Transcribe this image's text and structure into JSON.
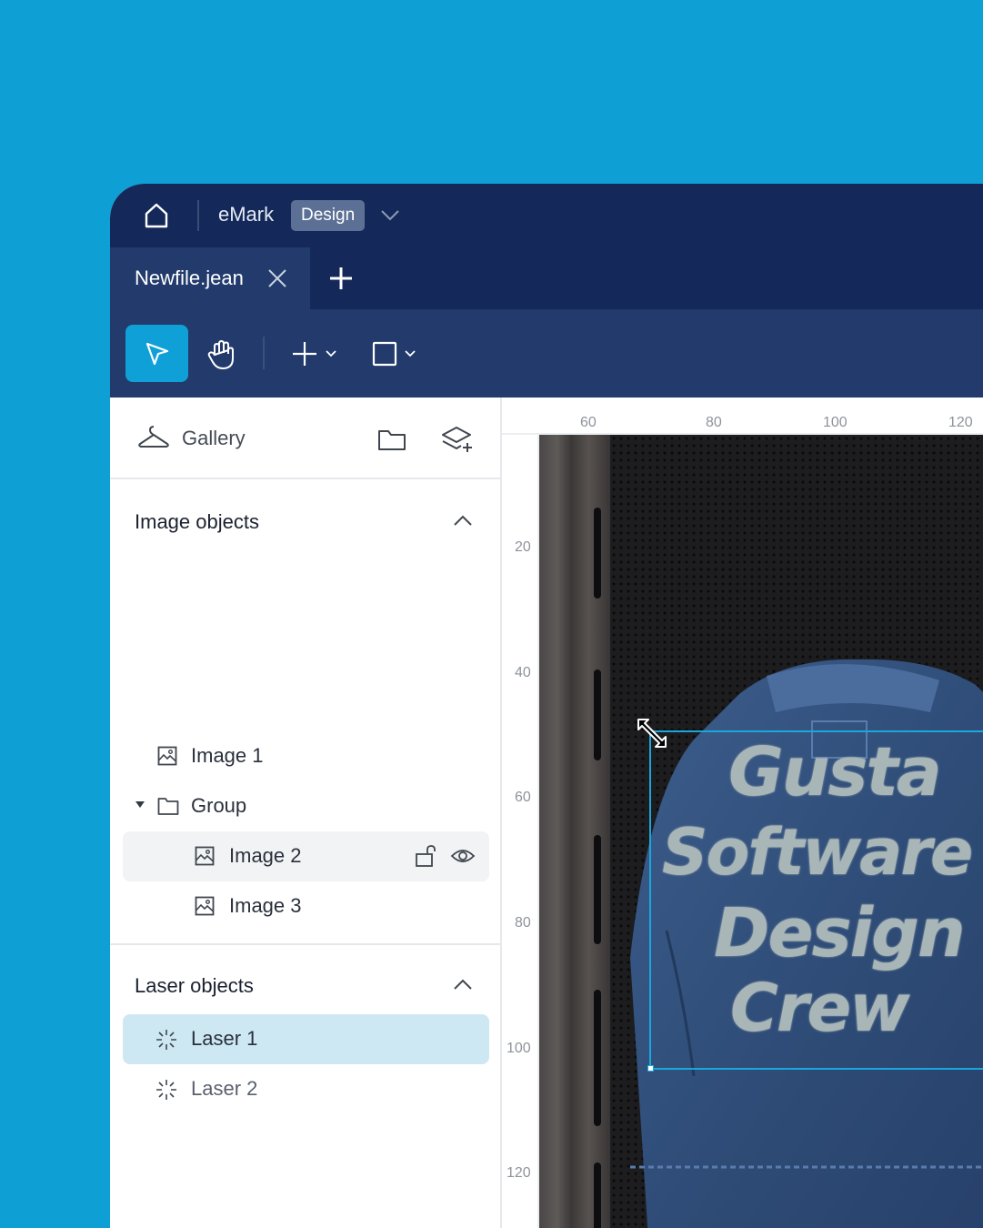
{
  "titlebar": {
    "app_name": "eMark",
    "mode": "Design"
  },
  "tabs": [
    {
      "label": "Newfile.jean"
    }
  ],
  "toolbar": {
    "tools": [
      "select-tool",
      "hand-tool",
      "add-tool",
      "shape-tool"
    ],
    "accent": "#10a0d8"
  },
  "panel": {
    "gallery_label": "Gallery",
    "image_section": {
      "title": "Image objects",
      "items": [
        {
          "label": "Image 1"
        },
        {
          "label": "Group"
        },
        {
          "label": "Image 2"
        },
        {
          "label": "Image 3"
        }
      ]
    },
    "laser_section": {
      "title": "Laser objects",
      "items": [
        {
          "label": "Laser 1"
        },
        {
          "label": "Laser 2"
        }
      ]
    }
  },
  "rulers": {
    "top": [
      "60",
      "80",
      "100",
      "120"
    ],
    "left": [
      "20",
      "40",
      "60",
      "80",
      "100",
      "120"
    ]
  },
  "artwork": {
    "text_lines": [
      "Gusta",
      "Software",
      "Design",
      "Crew"
    ]
  },
  "colors": {
    "background": "#0e9fd4",
    "titlebar": "#14295a",
    "toolbar": "#223b6c",
    "selected_row": "#cde8f3",
    "selection_box": "#1aa7dc"
  }
}
